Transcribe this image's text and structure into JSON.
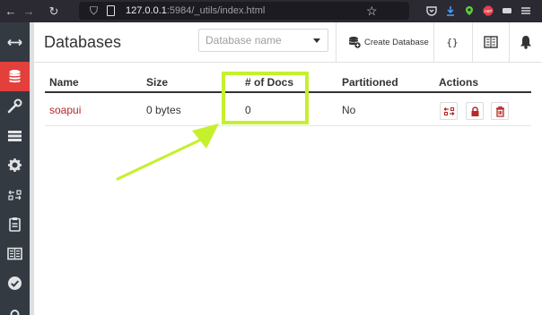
{
  "browser": {
    "url_host": "127.0.0.1",
    "url_rest": ":5984/_utils/index.html",
    "icons": [
      "back-arrow-icon",
      "forward-arrow-icon",
      "reload-icon",
      "shield-icon",
      "page-icon",
      "star-icon",
      "pocket-icon",
      "download-icon",
      "extension-icon",
      "adblock-icon",
      "menu-icon"
    ]
  },
  "sidebar": {
    "items": [
      {
        "name": "toggle-nav",
        "icon": "double-arrow-icon"
      },
      {
        "name": "databases",
        "icon": "database-icon",
        "active": true
      },
      {
        "name": "setup",
        "icon": "wrench-icon"
      },
      {
        "name": "active-tasks",
        "icon": "list-icon"
      },
      {
        "name": "config",
        "icon": "gear-icon"
      },
      {
        "name": "replication",
        "icon": "replicate-icon"
      },
      {
        "name": "documentation",
        "icon": "clipboard-icon"
      },
      {
        "name": "docs",
        "icon": "book-icon"
      },
      {
        "name": "verify",
        "icon": "check-circle-icon"
      },
      {
        "name": "user",
        "icon": "user-icon"
      }
    ]
  },
  "header": {
    "title": "Databases",
    "search_placeholder": "Database name",
    "create_label": "Create Database",
    "json_label": "{}"
  },
  "table": {
    "columns": [
      "Name",
      "Size",
      "# of Docs",
      "Partitioned",
      "Actions"
    ],
    "rows": [
      {
        "name": "soapui",
        "size": "0 bytes",
        "docs": "0",
        "partitioned": "No"
      }
    ]
  },
  "colors": {
    "accent": "#e33f3b",
    "sidebar": "#333a41",
    "link": "#b5292b",
    "annotation": "#c5f02e"
  }
}
